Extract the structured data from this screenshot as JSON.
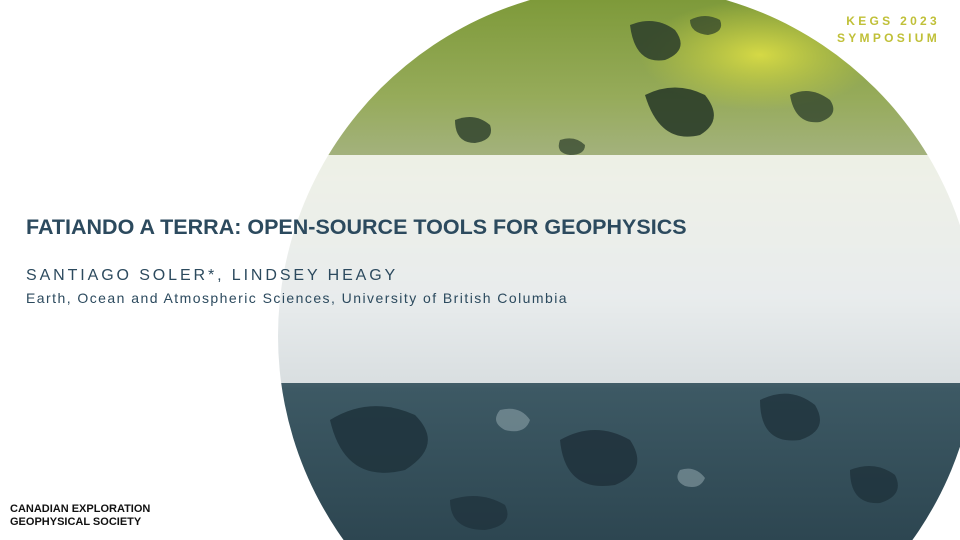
{
  "event": {
    "line1": "KEGS 2023",
    "line2": "SYMPOSIUM"
  },
  "title": "FATIANDO A TERRA: OPEN-SOURCE TOOLS FOR GEOPHYSICS",
  "authors": "SANTIAGO SOLER*, LINDSEY HEAGY",
  "affiliation": "Earth, Ocean and Atmospheric Sciences, University of British Columbia",
  "society": {
    "line1": "CANADIAN EXPLORATION",
    "line2": "GEOPHYSICAL SOCIETY"
  },
  "colors": {
    "title_text": "#2c4a5e",
    "event_accent": "#c0c038",
    "globe_green": "#8da64a",
    "globe_dark": "#2f4a57"
  }
}
